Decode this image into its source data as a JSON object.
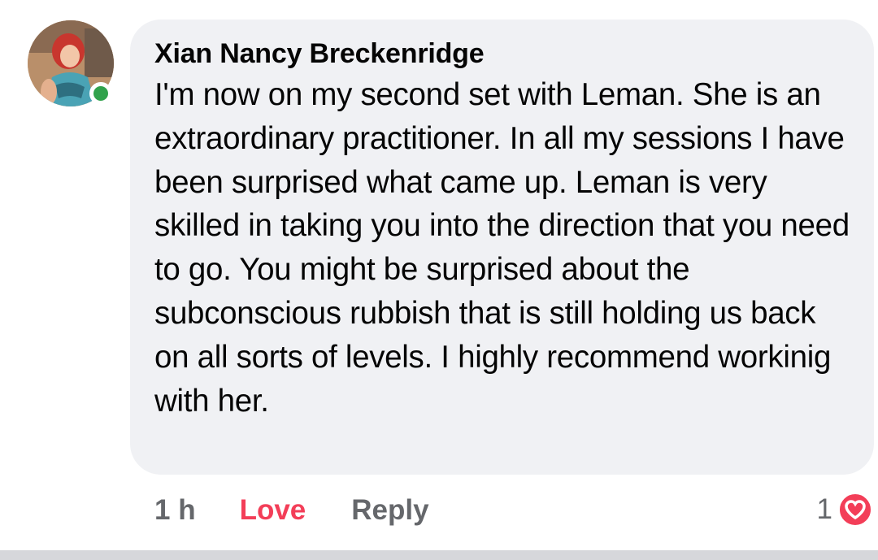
{
  "comment": {
    "author": "Xian Nancy Breckenridge",
    "text": "I'm now on my second set with Leman. She is an extraordinary practitioner. In all my sessions I have been surprised what came up. Leman is very skilled in taking you into the direction that you need to go. You might be surprised about the subconscious rubbish that is still holding us back on all sorts of levels. I highly recommend workinig with her.",
    "online": true
  },
  "actions": {
    "timestamp": "1 h",
    "love_label": "Love",
    "reply_label": "Reply"
  },
  "reactions": {
    "count": "1",
    "type": "heart-icon"
  },
  "colors": {
    "bubble": "#f0f1f4",
    "love": "#f33e58",
    "muted": "#65676b",
    "online": "#31a24c"
  }
}
